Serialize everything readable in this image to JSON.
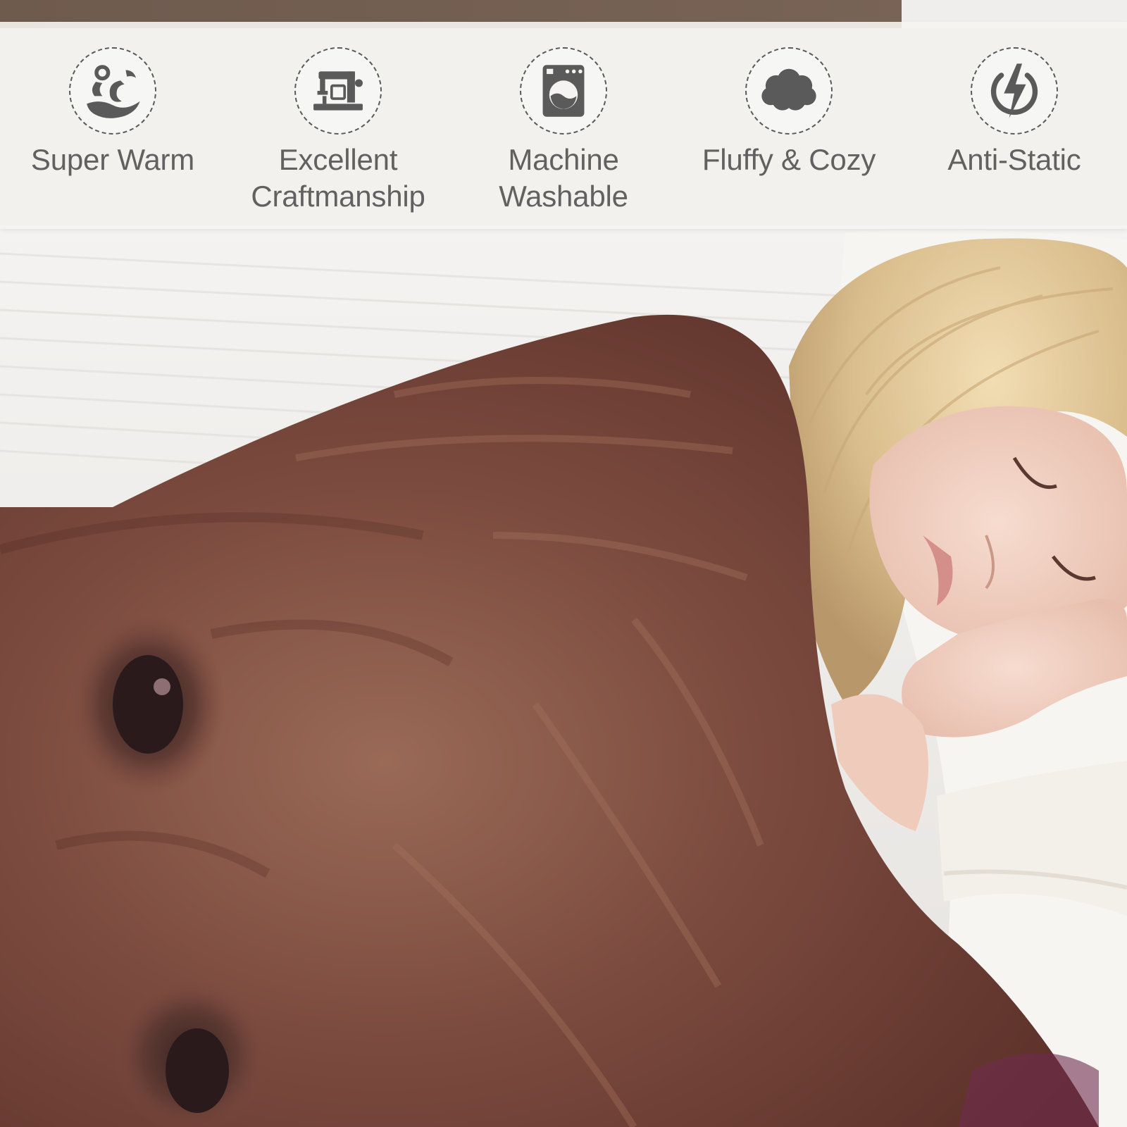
{
  "features": [
    {
      "label": "Super Warm",
      "icon": "heat-wave-icon"
    },
    {
      "label": "Excellent\nCraftmanship",
      "icon": "sewing-machine-icon"
    },
    {
      "label": "Machine\nWashable",
      "icon": "washing-machine-icon"
    },
    {
      "label": "Fluffy & Cozy",
      "icon": "cloud-icon"
    },
    {
      "label": "Anti-Static",
      "icon": "lightning-bolt-icon"
    }
  ],
  "colors": {
    "icon_gray": "#5a5a5a",
    "label_gray": "#616161",
    "blanket_brown": "#7a4a3d",
    "sheet_white": "#f2f1ef"
  }
}
